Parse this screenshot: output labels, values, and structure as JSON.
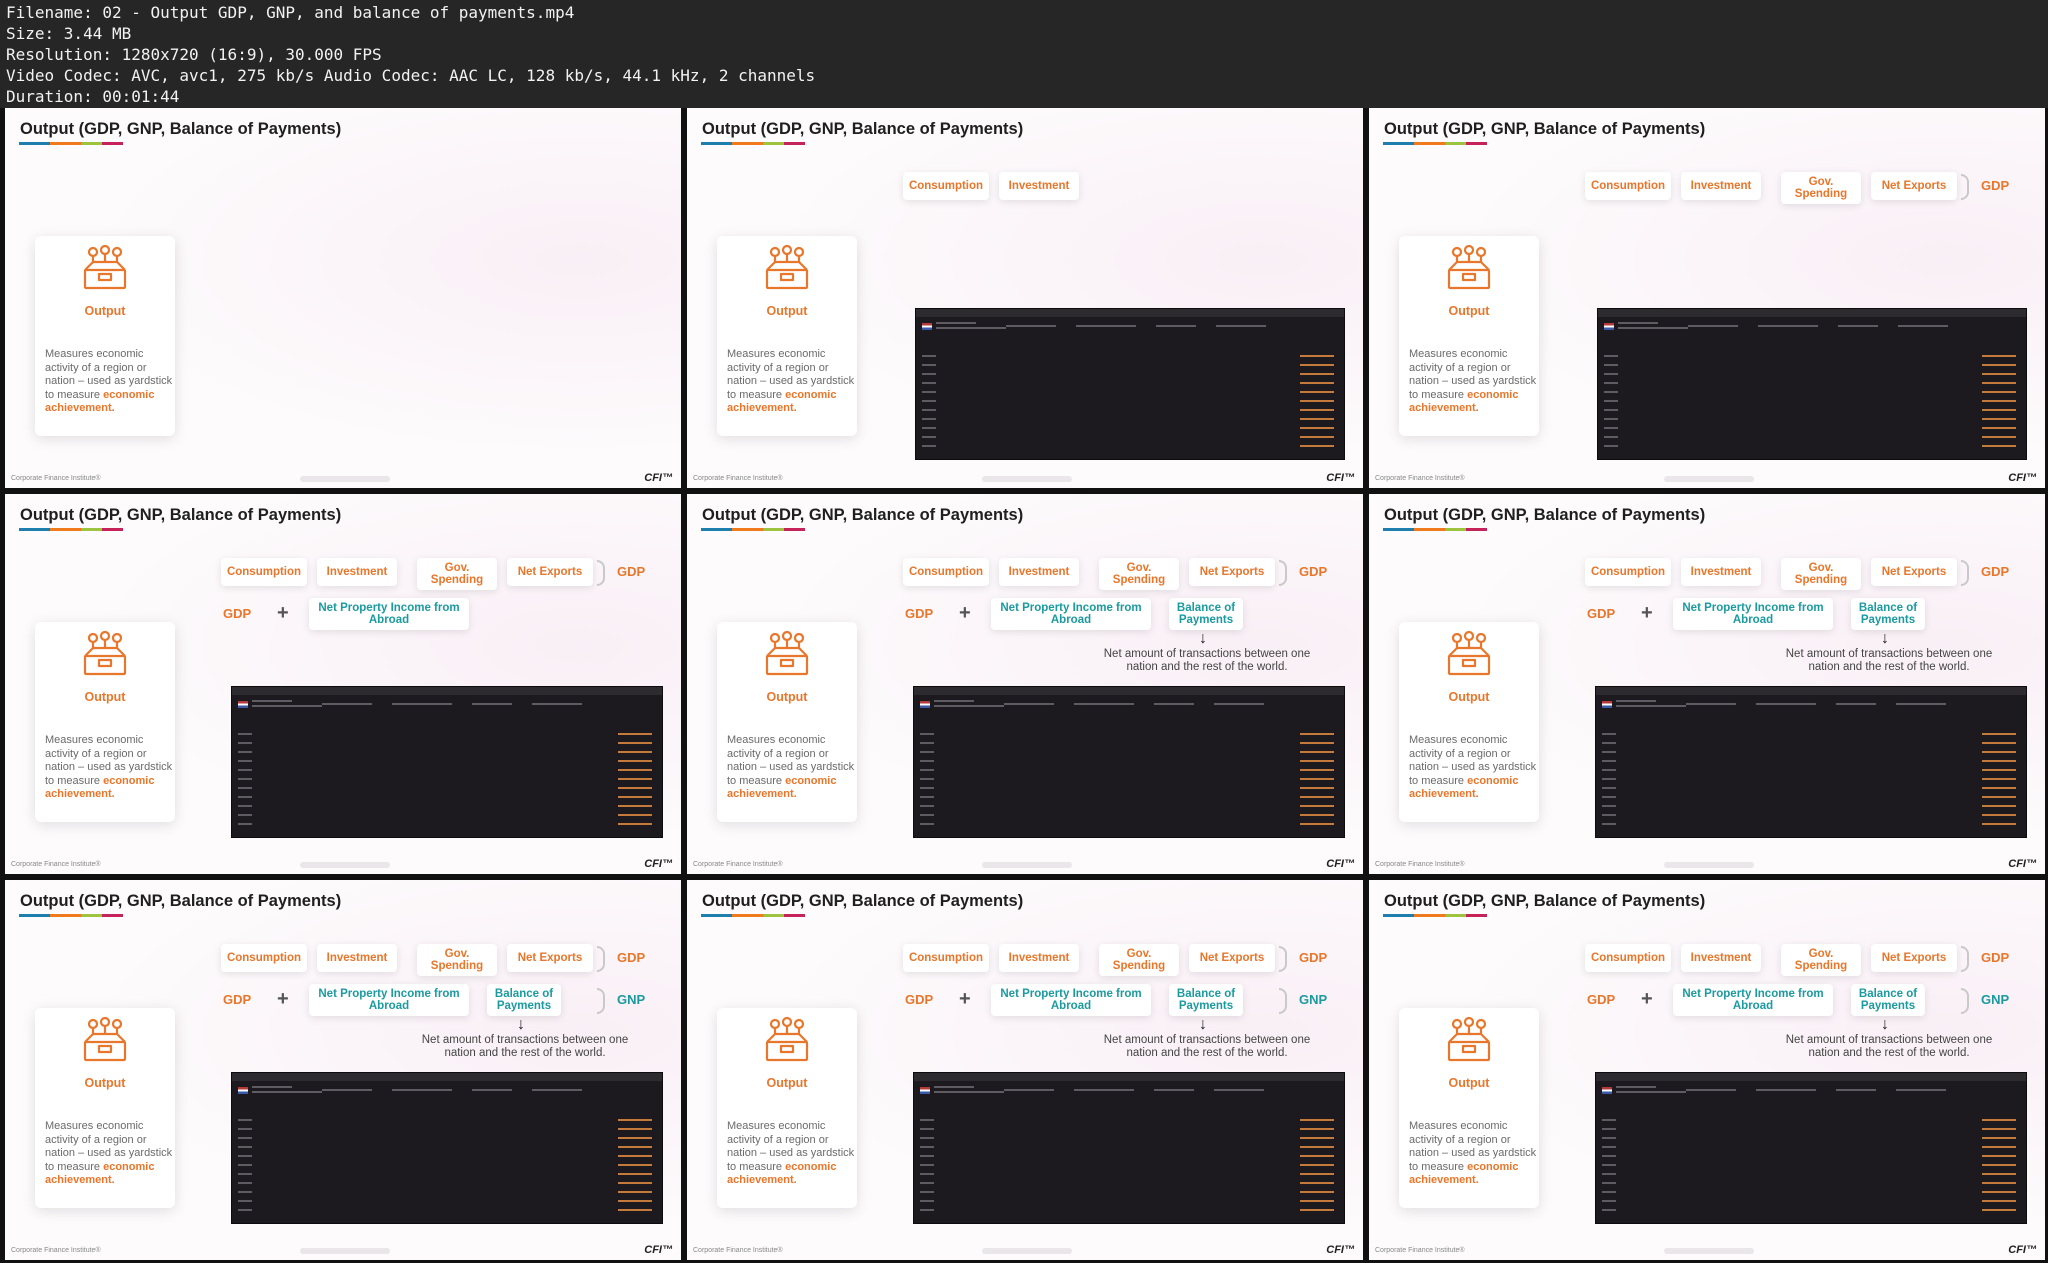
{
  "file_info": {
    "filename": "Filename: 02 - Output GDP, GNP, and balance of payments.mp4",
    "size": "Size: 3.44 MB",
    "resolution": "Resolution: 1280x720 (16:9), 30.000 FPS",
    "video": "Video Codec: AVC, avc1, 275 kb/s Audio Codec: AAC LC, 128 kb/s, 44.1 kHz, 2 channels",
    "duration": "Duration: 00:01:44"
  },
  "slide": {
    "title": "Output (GDP, GNP, Balance of Payments)",
    "output_label": "Output",
    "output_desc": "Measures economic activity of a region or nation – used as yardstick to measure",
    "output_desc_em": "economic achievement.",
    "consumption": "Consumption",
    "investment": "Investment",
    "gov_spending": "Gov. Spending",
    "net_exports": "Net Exports",
    "gdp": "GDP",
    "gnp": "GNP",
    "plus": "+",
    "net_property": "Net Property Income from Abroad",
    "bop": "Balance of Payments",
    "bop_note": "Net amount of transactions between one nation and the rest of the world.",
    "footer": "Corporate Finance Institute®",
    "brand": "CFI™",
    "arrow": "↓"
  },
  "frames": [
    {
      "stage": 0
    },
    {
      "stage": 1
    },
    {
      "stage": 2
    },
    {
      "stage": 3
    },
    {
      "stage": 4
    },
    {
      "stage": 4
    },
    {
      "stage": 5
    },
    {
      "stage": 5
    },
    {
      "stage": 5
    }
  ]
}
